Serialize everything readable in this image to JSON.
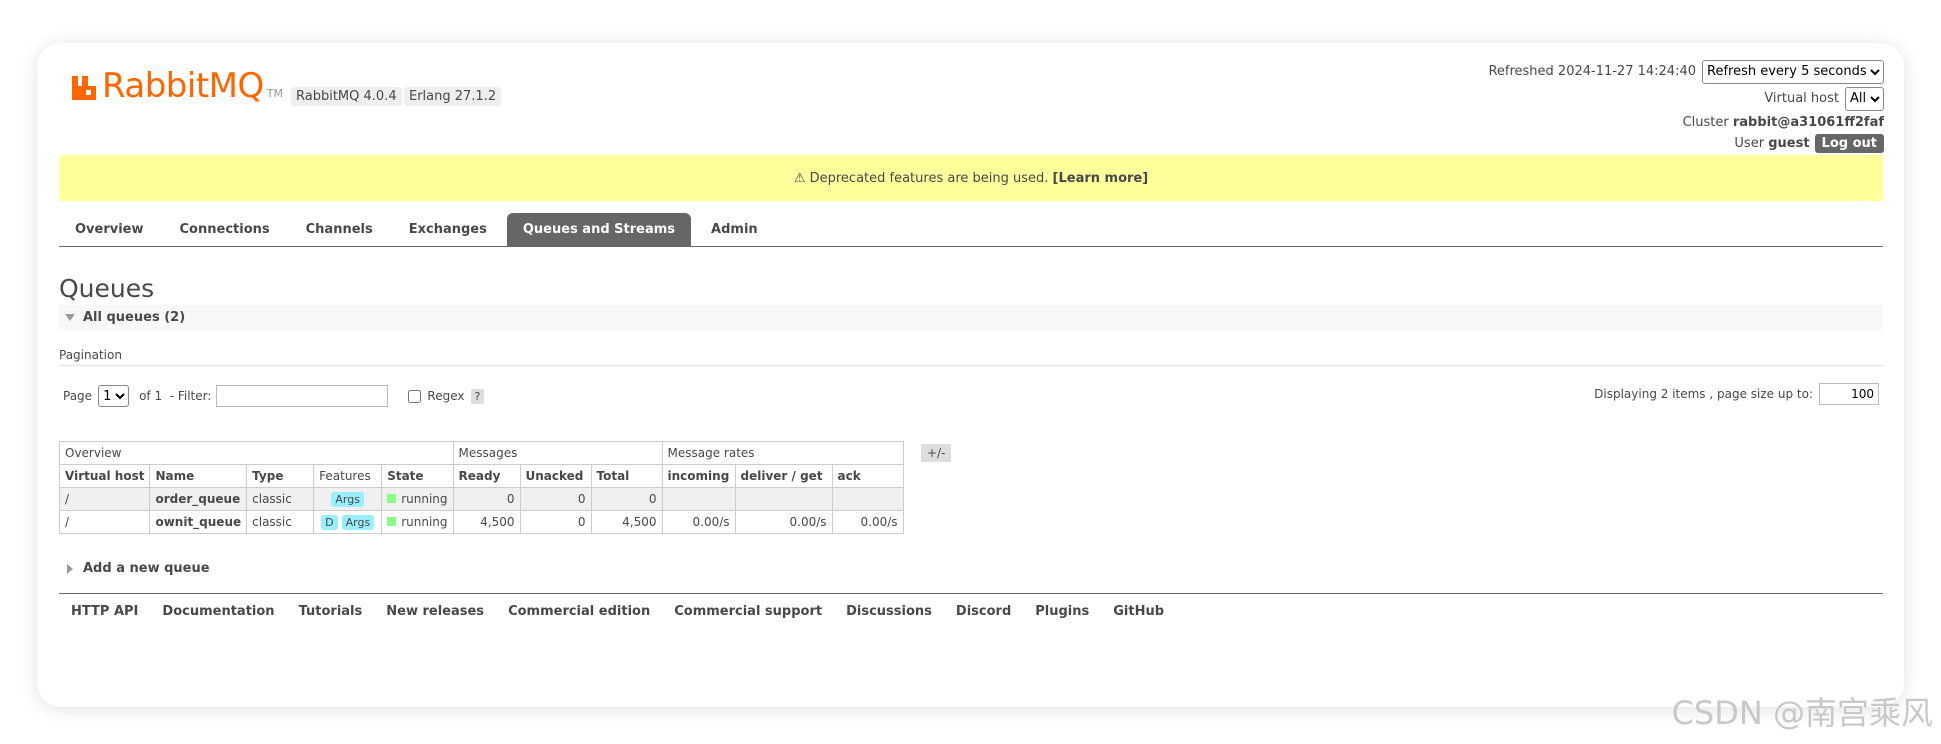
{
  "app": {
    "logo_text": "RabbitMQ",
    "logo_tm": "TM",
    "version": "RabbitMQ 4.0.4",
    "erlang": "Erlang 27.1.2",
    "brand_color": "#ff6600"
  },
  "status": {
    "refreshed_label": "Refreshed 2024-11-27 14:24:40",
    "refresh_option": "Refresh every 5 seconds",
    "vhost_label": "Virtual host",
    "vhost_value": "All",
    "cluster_label": "Cluster",
    "cluster_value": "rabbit@a31061ff2faf",
    "user_label": "User",
    "user_value": "guest",
    "logout_label": "Log out"
  },
  "banner": {
    "text": "⚠ Deprecated features are being used.",
    "link": "[Learn more]"
  },
  "tabs": [
    {
      "label": "Overview"
    },
    {
      "label": "Connections"
    },
    {
      "label": "Channels"
    },
    {
      "label": "Exchanges"
    },
    {
      "label": "Queues and Streams",
      "active": true
    },
    {
      "label": "Admin"
    }
  ],
  "page": {
    "title": "Queues",
    "section_label": "All queues (2)",
    "pagination_title": "Pagination"
  },
  "pager": {
    "page_label": "Page",
    "page_value": "1",
    "of_label": "of 1",
    "filter_label": "- Filter:",
    "regex_label": "Regex",
    "help_label": "?",
    "display_label": "Displaying 2 items , page size up to:",
    "page_size": "100"
  },
  "table": {
    "groups": [
      "Overview",
      "Messages",
      "Message rates"
    ],
    "toggle_label": "+/-",
    "headers": [
      "Virtual host",
      "Name",
      "Type",
      "Features",
      "State",
      "Ready",
      "Unacked",
      "Total",
      "incoming",
      "deliver / get",
      "ack"
    ],
    "rows": [
      {
        "vhost": "/",
        "name": "order_queue",
        "type": "classic",
        "features": [
          "Args"
        ],
        "state": "running",
        "ready": "0",
        "unacked": "0",
        "total": "0",
        "incoming": "",
        "deliver": "",
        "ack": ""
      },
      {
        "vhost": "/",
        "name": "ownit_queue",
        "type": "classic",
        "features": [
          "D",
          "Args"
        ],
        "state": "running",
        "ready": "4,500",
        "unacked": "0",
        "total": "4,500",
        "incoming": "0.00/s",
        "deliver": "0.00/s",
        "ack": "0.00/s"
      }
    ]
  },
  "add_queue_label": "Add a new queue",
  "footer": [
    "HTTP API",
    "Documentation",
    "Tutorials",
    "New releases",
    "Commercial edition",
    "Commercial support",
    "Discussions",
    "Discord",
    "Plugins",
    "GitHub"
  ],
  "watermark": "CSDN @南宫乘风"
}
